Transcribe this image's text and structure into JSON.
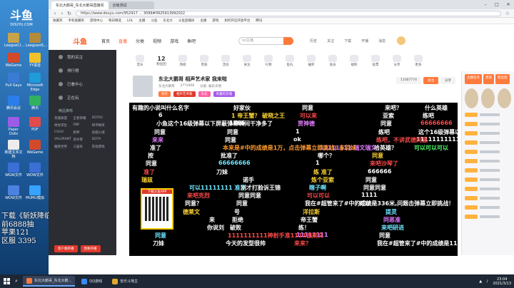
{
  "desktop": {
    "logo_text": "斗鱼",
    "logo_sub": "DOUYU.COM",
    "icons": [
      {
        "label": "LeagueCl...",
        "color": "#c7a349"
      },
      {
        "label": "LeagueofL...",
        "color": "#b28b3d"
      },
      {
        "label": "WeGame",
        "color": "#d34a2b"
      },
      {
        "label": "YY语音",
        "color": "#f2c22a"
      },
      {
        "label": "Full Gays",
        "color": "#3a7bd5"
      },
      {
        "label": "Microsoft Edge",
        "color": "#1e9bd8"
      },
      {
        "label": "腾讯会议",
        "color": "#2b7de9"
      },
      {
        "label": "腾讯",
        "color": "#30b15f"
      },
      {
        "label": "Paper Dolls",
        "color": "#9b5de5"
      },
      {
        "label": "PDF",
        "color": "#e34b4b"
      },
      {
        "label": "新建文本文档",
        "color": "#ececec"
      },
      {
        "label": "WeGame",
        "color": "#d34a2b"
      },
      {
        "label": "WGW文件",
        "color": "#3b6fd6"
      },
      {
        "label": "WOW文件",
        "color": "#3b6fd6"
      },
      {
        "label": "WOW文件",
        "color": "#4b82e0"
      },
      {
        "label": "MUMU模拟",
        "color": "#35a3ff"
      }
    ],
    "watermark_lines": [
      "下载《斩妖降临》",
      "前6888抽",
      "苹果121",
      "区服 3395"
    ]
  },
  "browser": {
    "tabs": [
      {
        "title": "东北大鹅哥_东北大鹅哥直播间",
        "active": true
      },
      {
        "title": "云吸测试",
        "active": false
      }
    ],
    "url": "https://www.douyu.com/952917 ... 3099#0925913992022",
    "bookmarks": [
      "收藏夹",
      "手机收藏夹",
      "游戏中心",
      "每日精选",
      "LOL",
      "主播",
      "斗鱼",
      "东北大",
      "斗鱼直播间",
      "主播",
      "游戏",
      "如何开启开放平台",
      "腾讯"
    ]
  },
  "site": {
    "logo": "斗鱼",
    "nav": [
      "首页",
      "直播",
      "分类",
      "视频",
      "游戏",
      "鱼吧"
    ],
    "nav_active_index": 1,
    "search_placeholder": "lol主播",
    "header_icons": [
      "历史",
      "关注",
      "下载",
      "开播",
      "消息"
    ]
  },
  "sidebar": {
    "items": [
      "我的关注",
      "排行榜",
      "已看中心",
      "正在玩"
    ],
    "section_label": "精品推荐",
    "games": [
      "英雄联盟",
      "王者荣耀",
      "DOTA2",
      "绝地求生",
      "DNF",
      "和平精英",
      "CSGO",
      "原神",
      "穿越火线",
      "VALORANT",
      "逆水寒",
      "DOTA",
      "魔兽世界",
      "三国杀",
      "其他游戏"
    ],
    "bottom_buttons": [
      "客户端开播",
      "我要开播"
    ]
  },
  "category_bar": {
    "items": [
      {
        "label": "音乐",
        "num": ""
      },
      {
        "label": "粉丝团",
        "num": "12"
      },
      {
        "label": "周榜",
        "num": ""
      },
      {
        "label": "贵族",
        "num": ""
      },
      {
        "label": "活动",
        "num": ""
      },
      {
        "label": "关注",
        "num": ""
      },
      {
        "label": "礼物",
        "num": ""
      },
      {
        "label": "鱼丸",
        "num": ""
      },
      {
        "label": "抽奖",
        "num": ""
      },
      {
        "label": "会员",
        "num": ""
      },
      {
        "label": "福利",
        "num": ""
      },
      {
        "label": "投票",
        "num": ""
      },
      {
        "label": "分享",
        "num": ""
      },
      {
        "label": "更多",
        "num": ""
      }
    ]
  },
  "room": {
    "title": "东北大鹅哥 相声艺术家 我来啦",
    "anchor": "东北大鹅哥",
    "room_no": "27?1608",
    "sub": [
      "房间号",
      "分类: 娱乐天地",
      "主播等级"
    ],
    "tags": [
      {
        "text": "搞笑",
        "color": "#ff7a3d"
      },
      {
        "text": "相声艺术家",
        "color": "#e0382b"
      },
      {
        "text": "东北",
        "color": "#ff5fa2"
      },
      {
        "text": "有趣的灵魂",
        "color": "#a35be8"
      }
    ],
    "follow_label": "关注",
    "fans_count": "11007774",
    "share_label": "分享"
  },
  "danmaku": [
    {
      "text": "有趣的小说叫什么名字",
      "color": "w"
    },
    {
      "text": "6",
      "color": "w"
    },
    {
      "text": "小鱼这个16级弹幕以下屏蔽弹幕瞬间干净多了",
      "color": "w"
    },
    {
      "text": "同意",
      "color": "w"
    },
    {
      "text": "来来",
      "color": "m"
    },
    {
      "text": "准了",
      "color": "w"
    },
    {
      "text": "按",
      "color": "w"
    },
    {
      "text": "同意",
      "color": "w"
    },
    {
      "text": "准了",
      "color": "r"
    },
    {
      "text": "瑞兹",
      "color": "y"
    },
    {
      "text": "可以11111111 准了",
      "color": "c"
    },
    {
      "text": "来吧克烈",
      "color": "r"
    },
    {
      "text": "同意？",
      "color": "w"
    },
    {
      "text": "德莱文",
      "color": "y"
    },
    {
      "text": "来",
      "color": "w"
    },
    {
      "text": "你说刘",
      "color": "w"
    },
    {
      "text": "同意",
      "color": "c"
    },
    {
      "text": "刀妹",
      "color": "w"
    },
    {
      "text": "好家伙",
      "color": "w"
    },
    {
      "text": "1 帝王蟹？ 破晓之王",
      "color": "y"
    },
    {
      "text": "1666",
      "color": "w"
    },
    {
      "text": "同意",
      "color": "w"
    },
    {
      "text": "同意",
      "color": "w"
    },
    {
      "text": "本来是#中的成绩是1万，点击弹幕立即挑战) 赤羽妹",
      "color": "o"
    },
    {
      "text": "批准了",
      "color": "w"
    },
    {
      "text": "66666666",
      "color": "c"
    },
    {
      "text": "刀妹",
      "color": "w"
    },
    {
      "text": "诺手",
      "color": "w"
    },
    {
      "text": "刚才打脸诉王锦",
      "color": "w"
    },
    {
      "text": "同意同意",
      "color": "w"
    },
    {
      "text": "同意",
      "color": "w"
    },
    {
      "text": "号",
      "color": "w"
    },
    {
      "text": "拒绝",
      "color": "w"
    },
    {
      "text": "破败",
      "color": "w"
    },
    {
      "text": "1111111111神射手准1111德莱文",
      "color": "r"
    },
    {
      "text": "今天的发型很帅",
      "color": "w"
    },
    {
      "text": "同意",
      "color": "w"
    },
    {
      "text": "可以来",
      "color": "r"
    },
    {
      "text": "贾神德",
      "color": "m"
    },
    {
      "text": "1",
      "color": "w"
    },
    {
      "text": "ok",
      "color": "w"
    },
    {
      "text": "11111111 瑞文瑞文",
      "color": "m"
    },
    {
      "text": "哪个？",
      "color": "w"
    },
    {
      "text": "1",
      "color": "w"
    },
    {
      "text": "练 准了",
      "color": "y"
    },
    {
      "text": "炼个亚索",
      "color": "y"
    },
    {
      "text": "瞎子啊",
      "color": "c"
    },
    {
      "text": "可以可以",
      "color": "r"
    },
    {
      "text": "我在#超管来了#中的成绩是336米,问题击弹幕立即挑战！",
      "color": "w"
    },
    {
      "text": "洋拉斯",
      "color": "y"
    },
    {
      "text": "帝王蟹",
      "color": "w"
    },
    {
      "text": "练！",
      "color": "w"
    },
    {
      "text": "11111111",
      "color": "m"
    },
    {
      "text": "来来？",
      "color": "r"
    },
    {
      "text": "来吧？",
      "color": "w"
    },
    {
      "text": "亚索",
      "color": "w"
    },
    {
      "text": "同意",
      "color": "w"
    },
    {
      "text": "练吧",
      "color": "w"
    },
    {
      "text": "练吧，不讲武德同意",
      "color": "r"
    },
    {
      "text": "哈英雄？",
      "color": "w"
    },
    {
      "text": "同意",
      "color": "y"
    },
    {
      "text": "来吧沙琴了",
      "color": "r"
    },
    {
      "text": "666666",
      "color": "w"
    },
    {
      "text": "同意",
      "color": "w"
    },
    {
      "text": "同意同意",
      "color": "w"
    },
    {
      "text": "1111",
      "color": "w"
    },
    {
      "text": "可以",
      "color": "w"
    },
    {
      "text": "提灵",
      "color": "c"
    },
    {
      "text": "同恶准",
      "color": "m"
    },
    {
      "text": "来吧研进",
      "color": "c"
    },
    {
      "text": "同意",
      "color": "w"
    },
    {
      "text": "我在#超管来了#中的成绩是113米，点击",
      "color": "w"
    },
    {
      "text": "什么英雄",
      "color": "w"
    },
    {
      "text": "练吧",
      "color": "w"
    },
    {
      "text": "66666666",
      "color": "r"
    },
    {
      "text": "这个16级弹幕以下屏蔽弹幕瞬间干净多了",
      "color": "w"
    },
    {
      "text": "1111111111111111",
      "color": "w"
    },
    {
      "text": "可以可以可以",
      "color": "g"
    }
  ],
  "qr": {
    "label": "下载斗鱼APP",
    "badge": "500"
  },
  "right_pane": {
    "buttons": [
      "主播任务",
      "贵族",
      "粉丝团"
    ],
    "rows": 12
  },
  "taskbar": {
    "tasks": [
      {
        "label": "东北大鹅哥_东北大鹅...",
        "color": "#ff7a3d",
        "active": true
      },
      {
        "label": "QQ游戏",
        "color": "#3b8af0",
        "active": false
      },
      {
        "label": "安乐斗地主",
        "color": "#e0a92b",
        "active": false
      }
    ],
    "time": "23:04",
    "date": "2021/3/13"
  }
}
